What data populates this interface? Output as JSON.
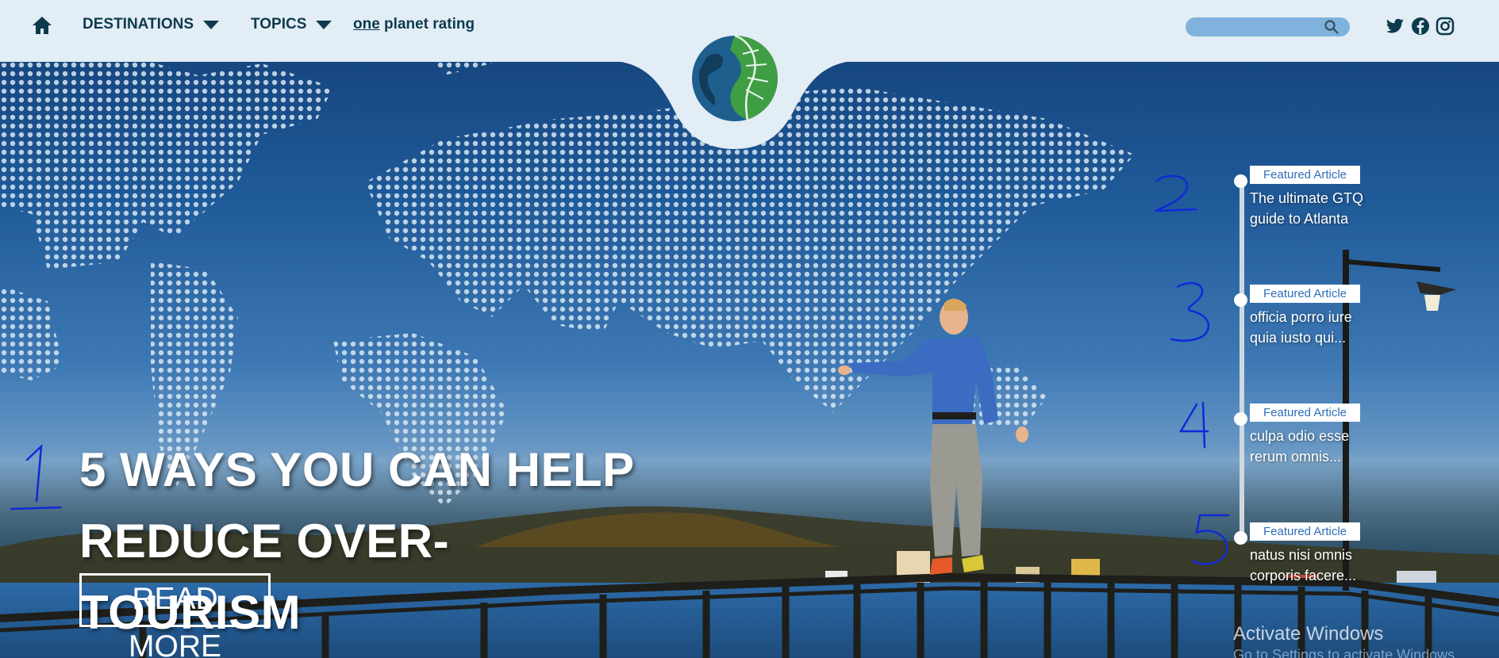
{
  "nav": {
    "destinations": "DESTINATIONS",
    "topics": "TOPICS",
    "rating_prefix": "one",
    "rating_rest": " planet rating"
  },
  "search": {
    "placeholder": ""
  },
  "hero": {
    "headline_line1": "5 WAYS YOU CAN HELP",
    "headline_line2": "REDUCE OVER-TOURISM",
    "read_more": "READ MORE"
  },
  "featured": [
    {
      "badge": "Featured Article",
      "title": "The ultimate GTQ guide to Atlanta"
    },
    {
      "badge": "Featured Article",
      "title": "officia porro iure quia iusto qui..."
    },
    {
      "badge": "Featured Article",
      "title": "culpa odio esse rerum omnis..."
    },
    {
      "badge": "Featured Article",
      "title": "natus nisi omnis corporis facere..."
    }
  ],
  "annotations": [
    "1",
    "2",
    "3",
    "4",
    "5"
  ],
  "watermark": {
    "title": "Activate Windows",
    "subtitle": "Go to Settings to activate Windows."
  },
  "colors": {
    "nav_bg": "#e3edf5",
    "nav_text": "#0c3b4c",
    "search_bg": "#7fb2dc",
    "badge_text": "#2f6db8",
    "annotation_ink": "#1029d8",
    "logo_green": "#3f9e44",
    "logo_blue": "#1f5f8e"
  },
  "icons": [
    "home-icon",
    "caret-down-icon",
    "search-icon",
    "twitter-icon",
    "facebook-icon",
    "instagram-icon",
    "leaf-globe-logo"
  ]
}
